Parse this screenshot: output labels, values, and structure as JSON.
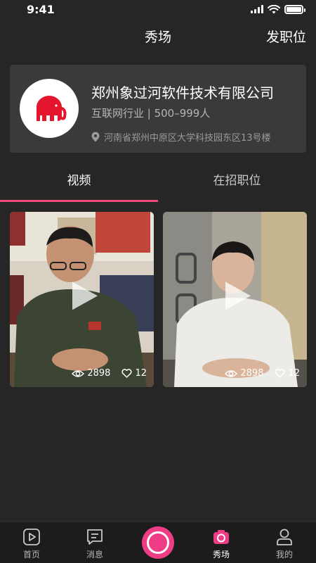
{
  "status_bar": {
    "time": "9:41"
  },
  "header": {
    "title": "秀场",
    "action_label": "发职位"
  },
  "company": {
    "name": "郑州象过河软件技术有限公司",
    "meta": "互联网行业 | 500–999人",
    "address": "河南省郑州中原区大学科技园东区13号楼",
    "logo_color": "#e3162d"
  },
  "tabs": [
    {
      "label": "视频",
      "active": true
    },
    {
      "label": "在招职位",
      "active": false
    }
  ],
  "videos": [
    {
      "views": "2898",
      "likes": "12"
    },
    {
      "views": "2898",
      "likes": "12"
    }
  ],
  "bottom_nav": {
    "items": [
      {
        "label": "首页",
        "icon": "play-square-icon"
      },
      {
        "label": "消息",
        "icon": "message-icon"
      },
      {
        "label": "秀场",
        "icon": "camera-icon",
        "active": true
      },
      {
        "label": "我的",
        "icon": "person-icon"
      }
    ],
    "record_color": "#ee3d86"
  },
  "colors": {
    "accent": "#f0487a",
    "background": "#262626",
    "card": "#3a3a3a"
  }
}
